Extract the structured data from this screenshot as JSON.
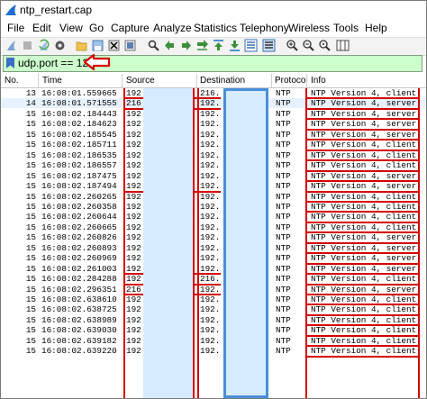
{
  "window": {
    "title": "ntp_restart.cap"
  },
  "menu": [
    "File",
    "Edit",
    "View",
    "Go",
    "Capture",
    "Analyze",
    "Statistics",
    "Telephony",
    "Wireless",
    "Tools",
    "Help"
  ],
  "filter": {
    "value": "udp.port == 123"
  },
  "columns": {
    "no": "No.",
    "time": "Time",
    "source": "Source",
    "destination": "Destination",
    "protocol": "Protocol",
    "info": "Info"
  },
  "packets": [
    {
      "no": "13",
      "time": "16:08:01.559665",
      "src": "192.",
      "dst": "216.",
      "proto": "NTP",
      "info": "NTP Version 4, client"
    },
    {
      "no": "14",
      "time": "16:08:01.571555",
      "src": "216.",
      "dst": "192.",
      "proto": "NTP",
      "info": "NTP Version 4, server"
    },
    {
      "no": "15",
      "time": "16:08:02.184443",
      "src": "192.",
      "dst": "192.",
      "proto": "NTP",
      "info": "NTP Version 4, server"
    },
    {
      "no": "15",
      "time": "16:08:02.184623",
      "src": "192.",
      "dst": "192.",
      "proto": "NTP",
      "info": "NTP Version 4, server"
    },
    {
      "no": "15",
      "time": "16:08:02.185545",
      "src": "192.",
      "dst": "192.",
      "proto": "NTP",
      "info": "NTP Version 4, server"
    },
    {
      "no": "15",
      "time": "16:08:02.185711",
      "src": "192.",
      "dst": "192.",
      "proto": "NTP",
      "info": "NTP Version 4, client"
    },
    {
      "no": "15",
      "time": "16:08:02.186535",
      "src": "192.",
      "dst": "192.",
      "proto": "NTP",
      "info": "NTP Version 4, client"
    },
    {
      "no": "15",
      "time": "16:08:02.186557",
      "src": "192.",
      "dst": "192.",
      "proto": "NTP",
      "info": "NTP Version 4, client"
    },
    {
      "no": "15",
      "time": "16:08:02.187475",
      "src": "192.",
      "dst": "192.",
      "proto": "NTP",
      "info": "NTP Version 4, server"
    },
    {
      "no": "15",
      "time": "16:08:02.187494",
      "src": "192.",
      "dst": "192.",
      "proto": "NTP",
      "info": "NTP Version 4, server"
    },
    {
      "no": "15",
      "time": "16:08:02.260265",
      "src": "192.",
      "dst": "192.",
      "proto": "NTP",
      "info": "NTP Version 4, client"
    },
    {
      "no": "15",
      "time": "16:08:02.260358",
      "src": "192.",
      "dst": "192.",
      "proto": "NTP",
      "info": "NTP Version 4, client"
    },
    {
      "no": "15",
      "time": "16:08:02.260644",
      "src": "192.",
      "dst": "192.",
      "proto": "NTP",
      "info": "NTP Version 4, client"
    },
    {
      "no": "15",
      "time": "16:08:02.260665",
      "src": "192.",
      "dst": "192.",
      "proto": "NTP",
      "info": "NTP Version 4, client"
    },
    {
      "no": "15",
      "time": "16:08:02.260826",
      "src": "192.",
      "dst": "192.",
      "proto": "NTP",
      "info": "NTP Version 4, server"
    },
    {
      "no": "15",
      "time": "16:08:02.260893",
      "src": "192.",
      "dst": "192.",
      "proto": "NTP",
      "info": "NTP Version 4, server"
    },
    {
      "no": "15",
      "time": "16:08:02.260969",
      "src": "192.",
      "dst": "192.",
      "proto": "NTP",
      "info": "NTP Version 4, server"
    },
    {
      "no": "15",
      "time": "16:08:02.261003",
      "src": "192.",
      "dst": "192.",
      "proto": "NTP",
      "info": "NTP Version 4, server"
    },
    {
      "no": "15",
      "time": "16:08:02.284288",
      "src": "192.",
      "dst": "216.",
      "proto": "NTP",
      "info": "NTP Version 4, client"
    },
    {
      "no": "15",
      "time": "16:08:02.296351",
      "src": "216.",
      "dst": "192.",
      "proto": "NTP",
      "info": "NTP Version 4, server"
    },
    {
      "no": "15",
      "time": "16:08:02.638610",
      "src": "192.",
      "dst": "192.",
      "proto": "NTP",
      "info": "NTP Version 4, client"
    },
    {
      "no": "15",
      "time": "16:08:02.638725",
      "src": "192.",
      "dst": "192.",
      "proto": "NTP",
      "info": "NTP Version 4, client"
    },
    {
      "no": "15",
      "time": "16:08:02.638989",
      "src": "192.",
      "dst": "192.",
      "proto": "NTP",
      "info": "NTP Version 4, client"
    },
    {
      "no": "15",
      "time": "16:08:02.639030",
      "src": "192.",
      "dst": "192.",
      "proto": "NTP",
      "info": "NTP Version 4, client"
    },
    {
      "no": "15",
      "time": "16:08:02.639182",
      "src": "192.",
      "dst": "192.",
      "proto": "NTP",
      "info": "NTP Version 4, client"
    },
    {
      "no": "15",
      "time": "16:08:02.639220",
      "src": "192.",
      "dst": "192.",
      "proto": "NTP",
      "info": "NTP Version 4, client"
    }
  ],
  "colors": {
    "filter_bg": "#ccffcc",
    "annotation_red": "#d40000",
    "annotation_blue": "#4a8fd9",
    "selected_row": "#e8f2fe",
    "shark_blue": "#1f6fd1"
  },
  "icons": [
    "wireshark-fin-icon",
    "start-capture-icon",
    "stop-capture-icon",
    "restart-capture-icon",
    "capture-options-icon",
    "open-file-icon",
    "save-file-icon",
    "close-file-icon",
    "reload-file-icon",
    "find-packet-icon",
    "go-back-icon",
    "go-forward-icon",
    "go-to-packet-icon",
    "go-first-icon",
    "go-last-icon",
    "autoscroll-icon",
    "colorize-icon",
    "zoom-in-icon",
    "zoom-out-icon",
    "normal-size-icon",
    "resize-columns-icon",
    "bookmark-icon",
    "callout-arrow-icon"
  ]
}
